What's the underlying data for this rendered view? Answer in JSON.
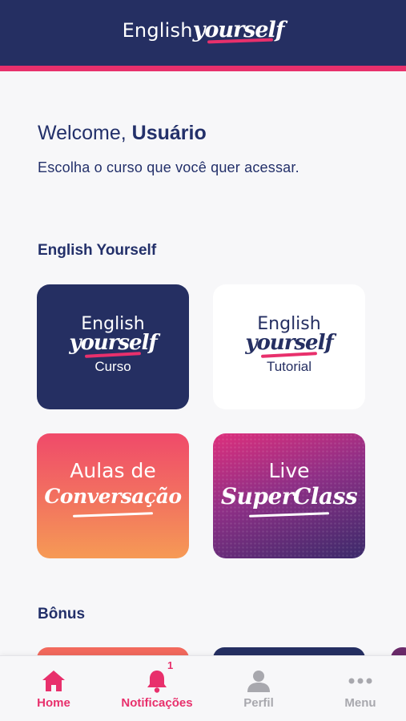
{
  "header": {
    "logo_english": "English",
    "logo_yourself": "yourself"
  },
  "welcome": {
    "greeting": "Welcome, ",
    "user_name": "Usuário",
    "subtitle": "Escolha o curso que você quer acessar."
  },
  "sections": [
    {
      "title": "English Yourself",
      "cards": [
        {
          "line1": "English",
          "line2": "yourself",
          "sub": "Curso"
        },
        {
          "line1": "English",
          "line2": "yourself",
          "sub": "Tutorial"
        },
        {
          "line1": "Aulas de",
          "line2": "Conversação"
        },
        {
          "line1": "Live",
          "line2": "SuperClass"
        }
      ]
    },
    {
      "title": "Bônus"
    }
  ],
  "bottom_nav": [
    {
      "label": "Home",
      "icon": "home-icon",
      "active": true
    },
    {
      "label": "Notificações",
      "icon": "bell-icon",
      "badge": "1"
    },
    {
      "label": "Perfil",
      "icon": "user-icon"
    },
    {
      "label": "Menu",
      "icon": "more-icon"
    }
  ],
  "colors": {
    "primary": "#252f62",
    "accent": "#e8306c",
    "inactive": "#a8a8ae",
    "background": "#f7f7f9"
  }
}
